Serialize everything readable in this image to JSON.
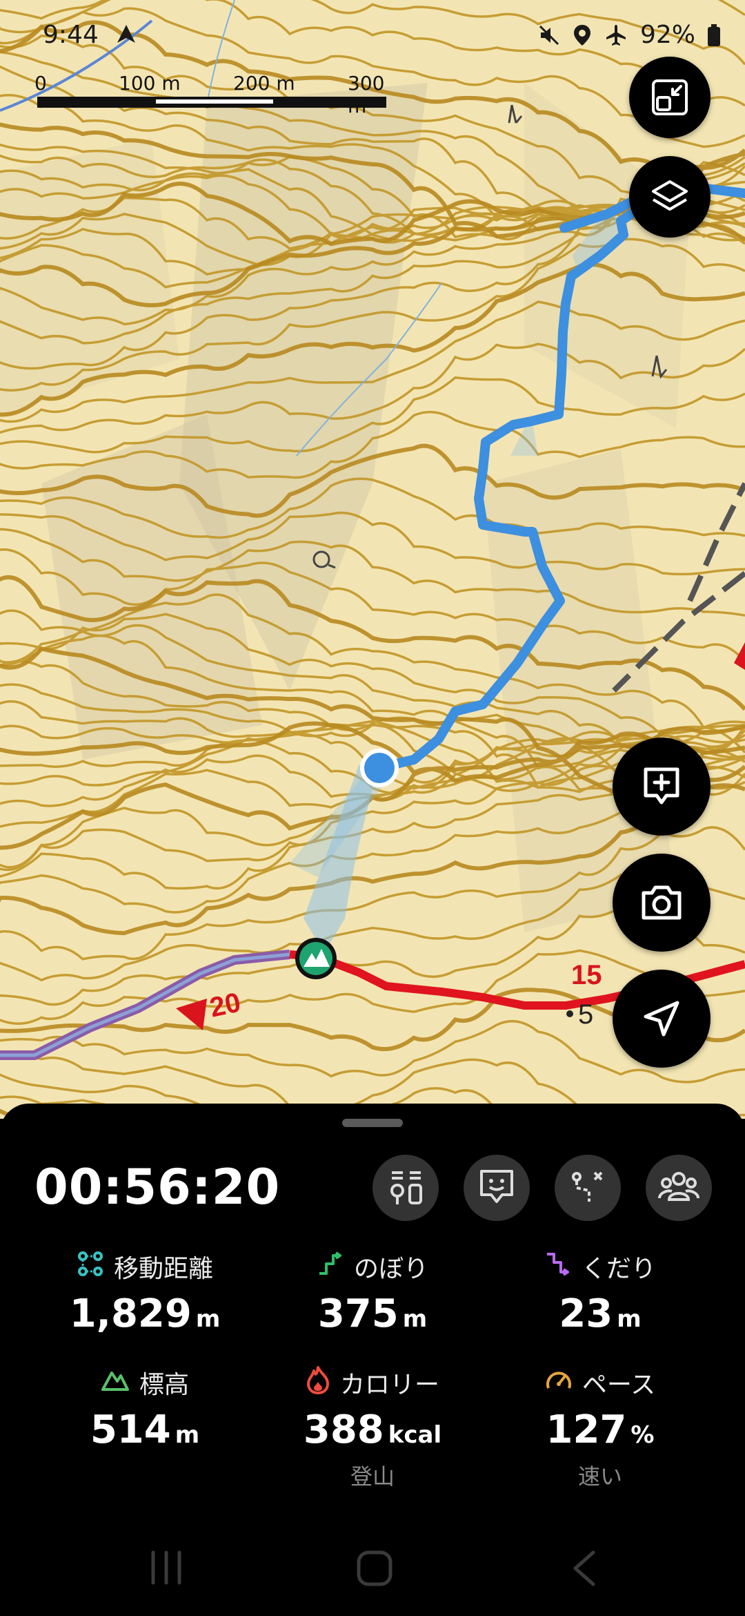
{
  "status_bar": {
    "time": "9:44",
    "battery": "92%",
    "icons": [
      "navigation-arrow-icon",
      "mute-icon",
      "location-icon",
      "airplane-icon",
      "battery-icon"
    ]
  },
  "scale_bar": {
    "labels": [
      "0",
      "100 m",
      "200 m",
      "300 m"
    ]
  },
  "map": {
    "route_labels": [
      "20",
      "15"
    ],
    "elevation_partial": "5",
    "colors": {
      "terrain": "#f3e5b3",
      "contour": "#c49a2e",
      "track": "#3d8fe0",
      "trail": "#e0141e",
      "summit_marker": "#1fa36f"
    }
  },
  "map_buttons": [
    "minimize-map-icon",
    "layers-icon",
    "add-memo-icon",
    "camera-icon",
    "navigate-icon"
  ],
  "sheet": {
    "timer": "00:56:20",
    "tools": [
      "map-pin-list-icon",
      "message-icon",
      "route-icon",
      "group-icon"
    ],
    "stats": [
      {
        "label": "移動距離",
        "value": "1,829",
        "unit": "m",
        "icon": "distance-icon",
        "sub": ""
      },
      {
        "label": "のぼり",
        "value": "375",
        "unit": "m",
        "icon": "ascent-icon",
        "sub": ""
      },
      {
        "label": "くだり",
        "value": "23",
        "unit": "m",
        "icon": "descent-icon",
        "sub": ""
      },
      {
        "label": "標高",
        "value": "514",
        "unit": "m",
        "icon": "elevation-icon",
        "sub": ""
      },
      {
        "label": "カロリー",
        "value": "388",
        "unit": "kcal",
        "icon": "calorie-icon",
        "sub": "登山"
      },
      {
        "label": "ペース",
        "value": "127",
        "unit": "%",
        "icon": "pace-icon",
        "sub": "速い"
      }
    ]
  },
  "nav_bar": [
    "recent-apps-icon",
    "home-icon",
    "back-icon"
  ]
}
